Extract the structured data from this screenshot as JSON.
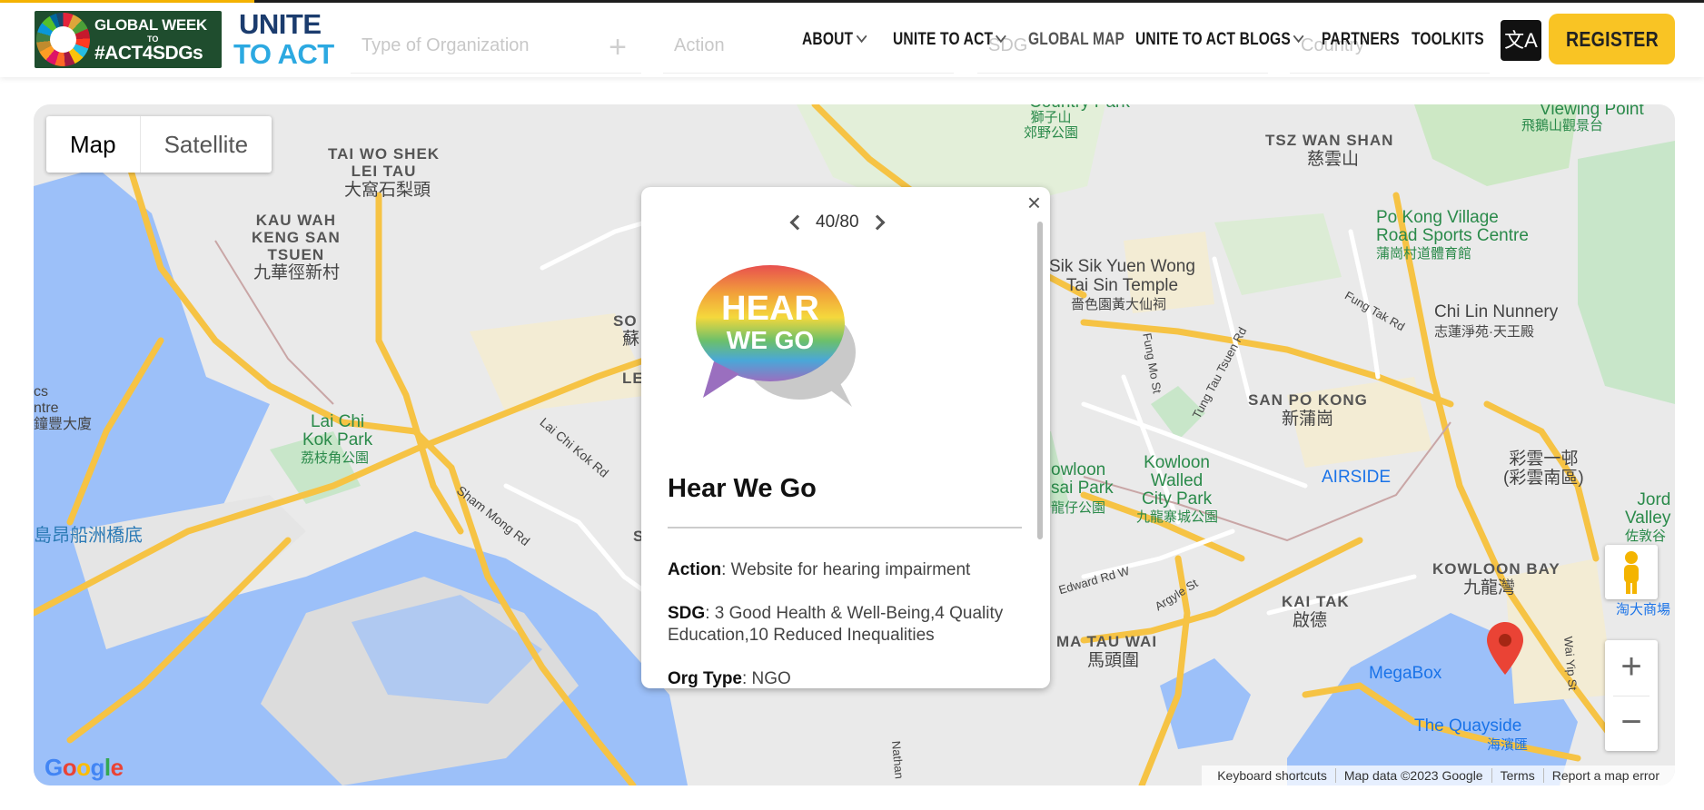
{
  "logo": {
    "line1": "GLOBAL WEEK",
    "line2": "TO",
    "line3": "#ACT4SDGs",
    "unite1": "UNITE",
    "unite2": "TO ACT"
  },
  "filters": {
    "organization": "Type of Organization",
    "action": "Action",
    "sdg": "SDG",
    "country": "Country"
  },
  "nav": {
    "about": "ABOUT",
    "unite_to_act": "UNITE TO ACT",
    "global_map": "GLOBAL MAP",
    "blogs": "UNITE TO ACT BLOGS",
    "partners": "PARTNERS",
    "toolkits": "TOOLKITS",
    "register": "REGISTER",
    "translate_glyph": "文A"
  },
  "map": {
    "type_map": "Map",
    "type_satellite": "Satellite",
    "google": "Google",
    "attribution": {
      "shortcuts": "Keyboard shortcuts",
      "data": "Map data ©2023 Google",
      "terms": "Terms",
      "report": "Report a map error"
    },
    "cluster_count": "80",
    "labels": {
      "tai_wo_shek_en": "TAI WO SHEK\nLEI TAU",
      "tai_wo_shek_zh": "大窩石梨頭",
      "kau_wah_en": "KAU WAH\nKENG SAN\nTSUEN",
      "kau_wah_zh": "九華徑新村",
      "lai_chi_kok_en": "Lai Chi\nKok Park",
      "lai_chi_kok_zh": "荔枝角公園",
      "tsz_wan_shan_en": "TSZ WAN SHAN",
      "tsz_wan_shan_zh": "慈雲山",
      "po_kong_en": "Po Kong Village\nRoad Sports Centre",
      "po_kong_zh": "蒲崗村道體育館",
      "sik_sik_en": "Sik Sik Yuen Wong\nTai Sin Temple",
      "sik_sik_zh": "嗇色園黃大仙祠",
      "chi_lin_en": "Chi Lin Nunnery",
      "chi_lin_zh": "志蓮淨苑·天王殿",
      "san_po_kong_en": "SAN PO KONG",
      "san_po_kong_zh": "新蒲崗",
      "airside": "AIRSIDE",
      "kowloon_walled_en": "Kowloon\nWalled\nCity Park",
      "kowloon_walled_zh": "九龍寨城公園",
      "kowloon_tsai_en": "owloon\nsai Park",
      "kowloon_tsai_zh": "龍仔公園",
      "kowloon_bay_en": "KOWLOON BAY",
      "kowloon_bay_zh": "九龍灣",
      "kai_tak_en": "KAI TAK",
      "kai_tak_zh": "啟德",
      "ma_tau_wai_en": "MA TAU WAI",
      "ma_tau_wai_zh": "馬頭圍",
      "megabox": "MegaBox",
      "quayside_en": "The Quayside",
      "quayside_zh": "海濱匯",
      "viewing_point_en": "Viewing Point",
      "viewing_point_zh": "飛鵝山觀景台",
      "choi_wan_zh": "彩雲一邨\n(彩雲南區)",
      "jordan_valley": "Jord\nValley",
      "jordan_valley_zh": "佐敦谷",
      "tao_da_zh": "淘大商場",
      "country_park_en": "Country Park",
      "country_park_zh": "獅子山\n郊野公園",
      "ngong_shun_zh": "昂船洲橋底",
      "ngong_shun_en": "島昂船洲橋底",
      "sham_mong": "Sham Mong Rd",
      "lai_chi_kok_rd": "Lai Chi Kok Rd",
      "fung_mo": "Fung Mo St",
      "tung_tau": "Tung Tau Tsuen Rd",
      "fung_tak": "Fung Tak Rd",
      "edward": "Edward Rd W",
      "argyle": "Argyle St",
      "wai_yip": "Wai Yip St",
      "nathan": "Nathan",
      "ics": "cs\nntre\n鐘豐大廈",
      "so": "SO",
      "le": "LE",
      "s": "S",
      "zh_su": "蘇"
    }
  },
  "popup": {
    "pager": "40/80",
    "logo_line1": "HEAR",
    "logo_line2": "WE GO",
    "title": "Hear We Go",
    "action_label": "Action",
    "action_value": ": Website for hearing impairment",
    "sdg_label": "SDG",
    "sdg_value": ": 3 Good Health & Well-Being,4 Quality Education,10 Reduced Inequalities",
    "org_label": "Org Type",
    "org_value": ": NGO"
  }
}
